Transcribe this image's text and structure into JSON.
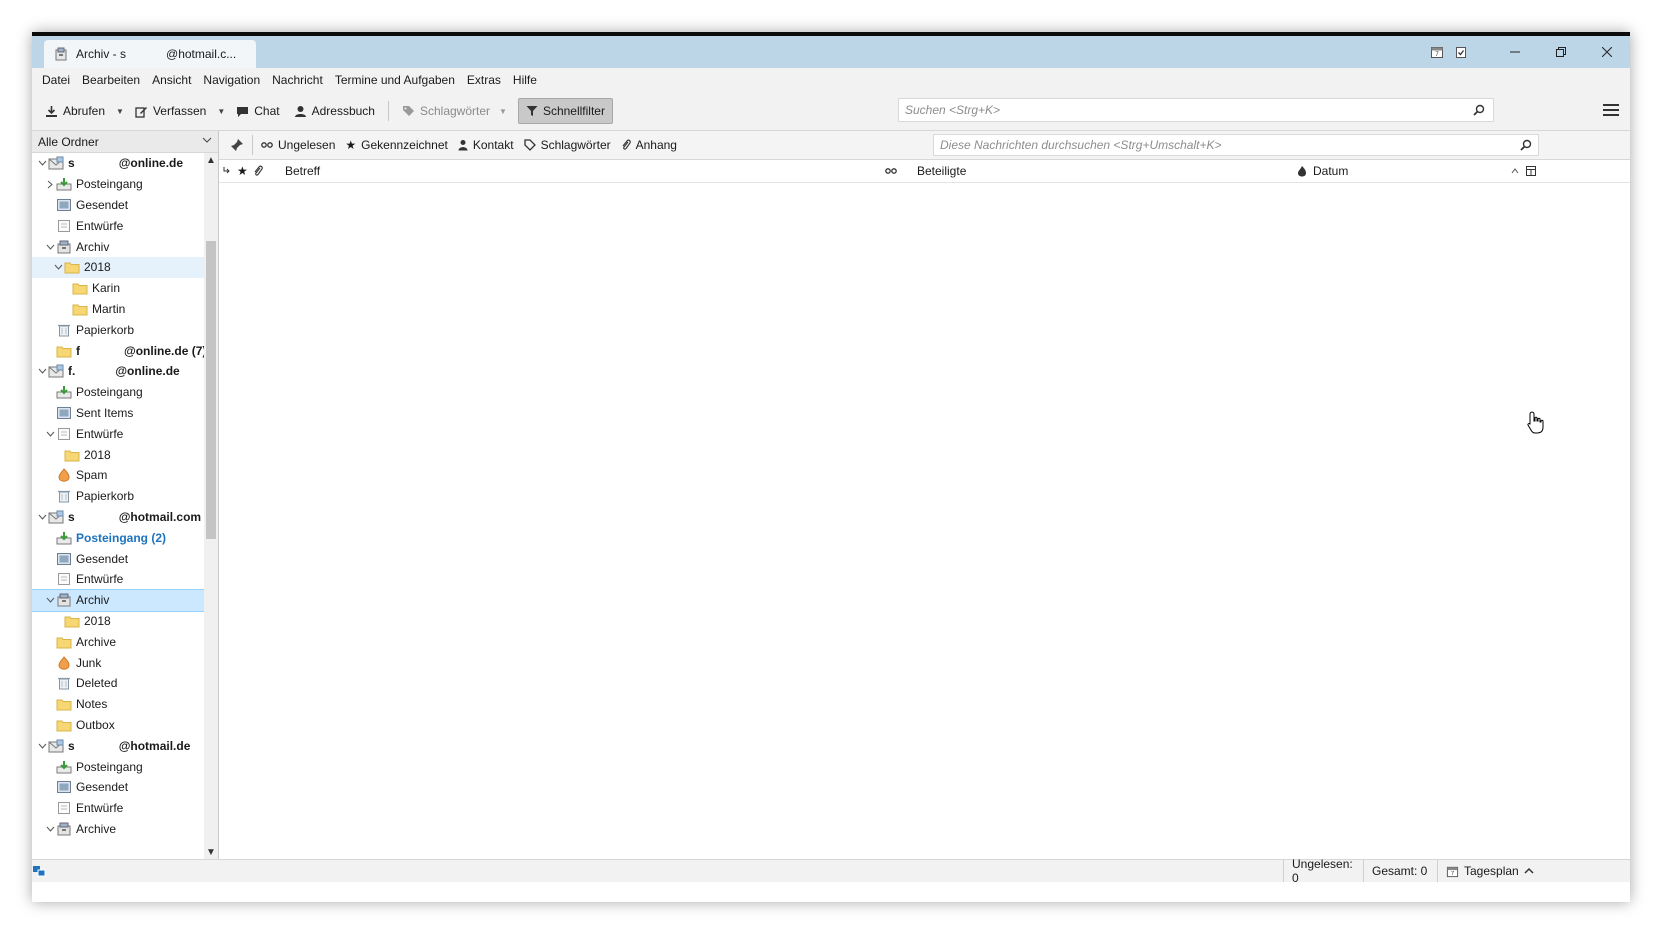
{
  "window": {
    "tab_title_left": "Archiv - s",
    "tab_title_right": "@hotmail.c..."
  },
  "menu": [
    "Datei",
    "Bearbeiten",
    "Ansicht",
    "Navigation",
    "Nachricht",
    "Termine und Aufgaben",
    "Extras",
    "Hilfe"
  ],
  "toolbar": {
    "abrufen": "Abrufen",
    "verfassen": "Verfassen",
    "chat": "Chat",
    "adressbuch": "Adressbuch",
    "schlagwoerter": "Schlagwörter",
    "schnellfilter": "Schnellfilter",
    "search_placeholder": "Suchen <Strg+K>"
  },
  "folder_pane": {
    "header": "Alle Ordner",
    "rows": [
      {
        "name": "s",
        "name2": "@online.de",
        "type": "account"
      },
      {
        "name": "Posteingang",
        "type": "inbox"
      },
      {
        "name": "Gesendet",
        "type": "sent"
      },
      {
        "name": "Entwürfe",
        "type": "drafts"
      },
      {
        "name": "Archiv",
        "type": "archive"
      },
      {
        "name": "2018",
        "type": "folder"
      },
      {
        "name": "Karin",
        "type": "folder"
      },
      {
        "name": "Martin",
        "type": "folder"
      },
      {
        "name": "Papierkorb",
        "type": "trash"
      },
      {
        "name": "f",
        "name2": "@online.de (7)",
        "type": "folder"
      },
      {
        "name": "f.",
        "name2": "@online.de",
        "type": "account"
      },
      {
        "name": "Posteingang",
        "type": "inbox"
      },
      {
        "name": "Sent Items",
        "type": "sent"
      },
      {
        "name": "Entwürfe",
        "type": "drafts"
      },
      {
        "name": "2018",
        "type": "folder"
      },
      {
        "name": "Spam",
        "type": "junk"
      },
      {
        "name": "Papierkorb",
        "type": "trash"
      },
      {
        "name": "s",
        "name2": "@hotmail.com",
        "type": "account"
      },
      {
        "name": "Posteingang (2)",
        "type": "inbox"
      },
      {
        "name": "Gesendet",
        "type": "sent"
      },
      {
        "name": "Entwürfe",
        "type": "drafts"
      },
      {
        "name": "Archiv",
        "type": "archive"
      },
      {
        "name": "2018",
        "type": "folder"
      },
      {
        "name": "Archive",
        "type": "folder"
      },
      {
        "name": "Junk",
        "type": "junk"
      },
      {
        "name": "Deleted",
        "type": "trash"
      },
      {
        "name": "Notes",
        "type": "folder"
      },
      {
        "name": "Outbox",
        "type": "folder"
      },
      {
        "name": "s",
        "name2": "@hotmail.de",
        "type": "account"
      },
      {
        "name": "Posteingang",
        "type": "inbox"
      },
      {
        "name": "Gesendet",
        "type": "sent"
      },
      {
        "name": "Entwürfe",
        "type": "drafts"
      },
      {
        "name": "Archive",
        "type": "archive"
      }
    ]
  },
  "quickfilter": {
    "ungelesen": "Ungelesen",
    "gekennzeichnet": "Gekennzeichnet",
    "kontakt": "Kontakt",
    "schlagwoerter": "Schlagwörter",
    "anhang": "Anhang",
    "search_placeholder": "Diese Nachrichten durchsuchen <Strg+Umschalt+K>"
  },
  "columns": {
    "betreff": "Betreff",
    "beteiligte": "Beteiligte",
    "datum": "Datum"
  },
  "status": {
    "ungelesen": "Ungelesen: 0",
    "gesamt": "Gesamt: 0",
    "tagesplan": "Tagesplan"
  },
  "colors": {
    "titlebar": "#bcd6e8",
    "selection": "#cce8ff",
    "unread_folder": "#1e73be"
  }
}
